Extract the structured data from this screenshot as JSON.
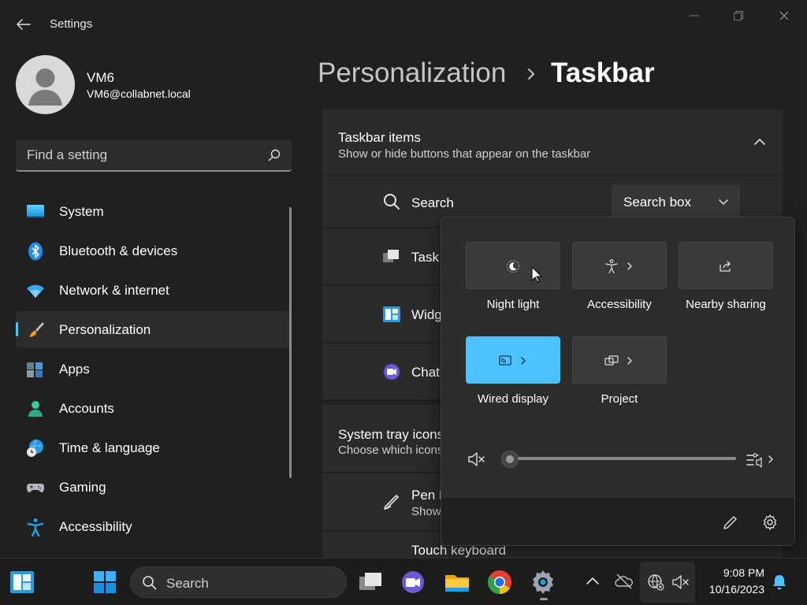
{
  "window": {
    "title": "Settings",
    "back_icon": "arrow-left-icon",
    "controls": [
      "minimize-icon",
      "restore-icon",
      "close-icon"
    ]
  },
  "profile": {
    "name": "VM6",
    "email": "VM6@collabnet.local"
  },
  "search": {
    "placeholder": "Find a setting",
    "icon": "search-icon"
  },
  "nav": {
    "items": [
      {
        "label": "System",
        "icon": "system-icon"
      },
      {
        "label": "Bluetooth & devices",
        "icon": "bluetooth-icon"
      },
      {
        "label": "Network & internet",
        "icon": "wifi-icon"
      },
      {
        "label": "Personalization",
        "icon": "brush-icon",
        "selected": true
      },
      {
        "label": "Apps",
        "icon": "apps-icon"
      },
      {
        "label": "Accounts",
        "icon": "accounts-icon"
      },
      {
        "label": "Time & language",
        "icon": "globe-clock-icon"
      },
      {
        "label": "Gaming",
        "icon": "gamepad-icon"
      },
      {
        "label": "Accessibility",
        "icon": "accessibility-icon"
      }
    ]
  },
  "breadcrumb": {
    "parent": "Personalization",
    "current": "Taskbar"
  },
  "main": {
    "taskbar_items": {
      "title": "Taskbar items",
      "subtitle": "Show or hide buttons that appear on the taskbar",
      "rows": [
        {
          "label": "Search",
          "icon": "search-icon",
          "control_value": "Search box"
        },
        {
          "label": "Task",
          "icon": "task-view-icon"
        },
        {
          "label": "Widg",
          "icon": "widgets-icon"
        },
        {
          "label": "Chat",
          "icon": "chat-icon"
        }
      ]
    },
    "system_tray": {
      "title": "System tray icons",
      "subtitle": "Choose which icons",
      "rows": [
        {
          "label": "Pen M",
          "sublabel": "Show",
          "icon": "pen-icon"
        },
        {
          "label": "Touch keyboard"
        }
      ]
    }
  },
  "quick_settings": {
    "tiles": [
      {
        "label": "Night light",
        "icon": "night-light-icon",
        "active": false,
        "chevron": false
      },
      {
        "label": "Accessibility",
        "icon": "accessibility-icon",
        "active": false,
        "chevron": true
      },
      {
        "label": "Nearby sharing",
        "icon": "share-icon",
        "active": false,
        "chevron": false
      },
      {
        "label": "Wired display",
        "icon": "cast-icon",
        "active": true,
        "chevron": true
      },
      {
        "label": "Project",
        "icon": "project-icon",
        "active": false,
        "chevron": true
      }
    ],
    "volume": {
      "level": 0,
      "muted": true
    },
    "accent": "#4cc2ff"
  },
  "taskbar": {
    "search_label": "Search",
    "time": "9:08 PM",
    "date": "10/16/2023"
  }
}
